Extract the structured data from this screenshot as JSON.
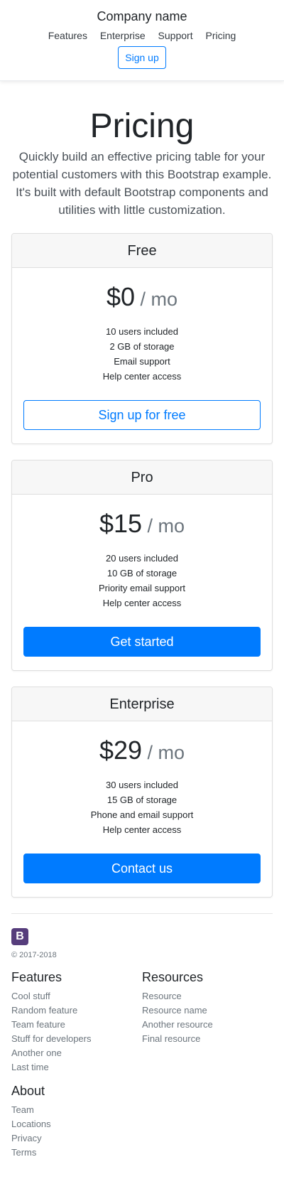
{
  "header": {
    "brand": "Company name",
    "nav": [
      "Features",
      "Enterprise",
      "Support",
      "Pricing"
    ],
    "signup": "Sign up"
  },
  "hero": {
    "title": "Pricing",
    "lead": "Quickly build an effective pricing table for your potential customers with this Bootstrap example. It's built with default Bootstrap components and utilities with little customization."
  },
  "plans": [
    {
      "name": "Free",
      "price": "$0",
      "period": " / mo",
      "features": [
        "10 users included",
        "2 GB of storage",
        "Email support",
        "Help center access"
      ],
      "button": "Sign up for free"
    },
    {
      "name": "Pro",
      "price": "$15",
      "period": " / mo",
      "features": [
        "20 users included",
        "10 GB of storage",
        "Priority email support",
        "Help center access"
      ],
      "button": "Get started"
    },
    {
      "name": "Enterprise",
      "price": "$29",
      "period": " / mo",
      "features": [
        "30 users included",
        "15 GB of storage",
        "Phone and email support",
        "Help center access"
      ],
      "button": "Contact us"
    }
  ],
  "footer": {
    "logo": "B",
    "copyright": "© 2017-2018",
    "features": {
      "title": "Features",
      "items": [
        "Cool stuff",
        "Random feature",
        "Team feature",
        "Stuff for developers",
        "Another one",
        "Last time"
      ]
    },
    "resources": {
      "title": "Resources",
      "items": [
        "Resource",
        "Resource name",
        "Another resource",
        "Final resource"
      ]
    },
    "about": {
      "title": "About",
      "items": [
        "Team",
        "Locations",
        "Privacy",
        "Terms"
      ]
    }
  },
  "colors": {
    "primary": "#007bff",
    "logo": "#563d7c",
    "muted": "#6c757d",
    "card_header": "#f7f7f7"
  }
}
